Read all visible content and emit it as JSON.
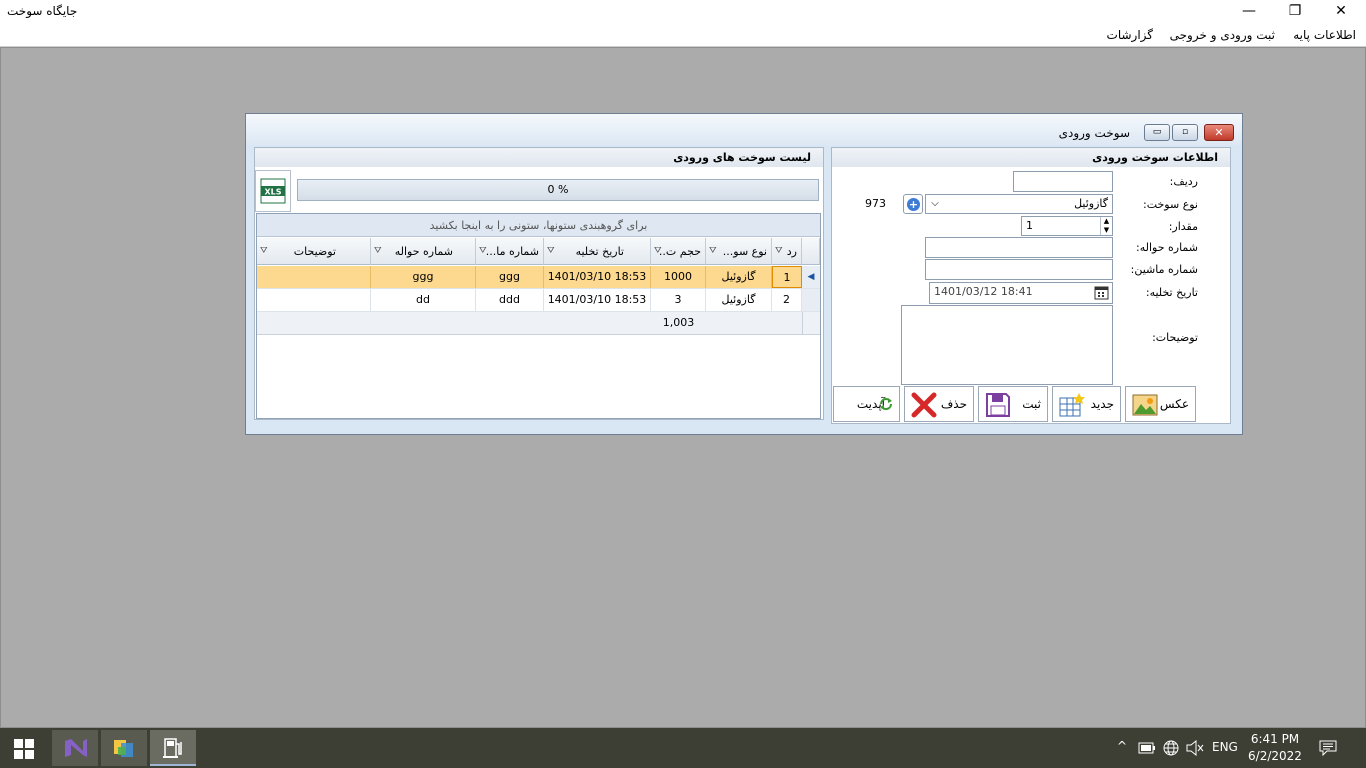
{
  "window": {
    "title": "جایگاه سوخت",
    "minimize_glyph": "—",
    "restore_glyph": "❐",
    "close_glyph": "✕"
  },
  "menu": {
    "items": [
      "اطلاعات پایه",
      "ثبت ورودی و خروجی",
      "گزارشات"
    ]
  },
  "child": {
    "title": "سوخت ورودی",
    "min_glyph": "▭",
    "max_glyph": "▫",
    "close_glyph": "✕"
  },
  "form": {
    "header": "اطلاعات سوخت ورودی",
    "row_label": "ردیف:",
    "row_value": "",
    "fuel_type_label": "نوع سوخت:",
    "fuel_type_value": "گازوئیل",
    "stock_value": "973",
    "amount_label": "مقدار:",
    "amount_value": "1",
    "transfer_no_label": "شماره حواله:",
    "transfer_no_value": "",
    "vehicle_no_label": "شماره ماشین:",
    "vehicle_no_value": "",
    "unload_date_label": "تاریخ تخلیه:",
    "unload_date_value": "1401/03/12 18:41",
    "notes_label": "توضیحات:",
    "notes_value": "",
    "buttons": {
      "photo": "عکس",
      "new": "جدید",
      "save": "ثبت",
      "delete": "حذف",
      "update": "آپدیت"
    }
  },
  "list": {
    "header": "لیست سوخت های ورودی",
    "xls_label": "XLS",
    "progress_text": "0 %",
    "group_panel_text": "برای گروهبندی ستونها، ستونی را به اینجا بکشید",
    "columns": [
      "رد",
      "نوع سو...",
      "حجم ت..",
      "تاریخ تخلیه",
      "شماره ما...",
      "شماره حواله",
      "توضیحات"
    ],
    "rows": [
      {
        "id": "1",
        "fuel": "گازوئیل",
        "volume": "1000",
        "date": "1401/03/10 18:53",
        "vehicle": "ggg",
        "transfer": "ggg",
        "notes": ""
      },
      {
        "id": "2",
        "fuel": "گازوئیل",
        "volume": "3",
        "date": "1401/03/10 18:53",
        "vehicle": "ddd",
        "transfer": "dd",
        "notes": ""
      }
    ],
    "total_volume": "1,003"
  },
  "taskbar": {
    "time": "6:41 PM",
    "date": "6/2/2022",
    "language": "ENG",
    "tray_chevron": "^"
  }
}
